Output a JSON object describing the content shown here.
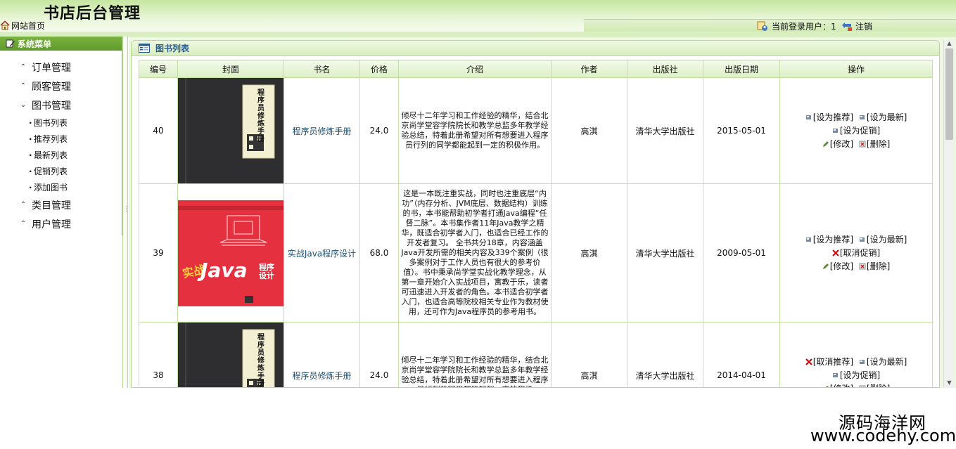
{
  "header": {
    "title": "书店后台管理",
    "home_link": "网站首页",
    "current_user_label": "当前登录用户：1",
    "logout_label": "注销"
  },
  "sidebar": {
    "title": "系统菜单",
    "groups": [
      {
        "label": "订单管理",
        "expanded": false
      },
      {
        "label": "顾客管理",
        "expanded": false
      },
      {
        "label": "图书管理",
        "expanded": true,
        "items": [
          "图书列表",
          "推荐列表",
          "最新列表",
          "促销列表",
          "添加图书"
        ]
      },
      {
        "label": "类目管理",
        "expanded": false
      },
      {
        "label": "用户管理",
        "expanded": false
      }
    ]
  },
  "panel": {
    "title": "图书列表"
  },
  "table": {
    "headers": [
      "编号",
      "封面",
      "书名",
      "价格",
      "介绍",
      "作者",
      "出版社",
      "出版日期",
      "操作"
    ],
    "rows": [
      {
        "id": "40",
        "name": "程序员修炼手册",
        "price": "24.0",
        "desc": "倾尽十二年学习和工作经验的精华，结合北京尚学堂容学院院长和教学总监多年教学经验总结，特着此册希望对所有想要进入程序员行列的同学都能起到一定的积极作用。",
        "author": "高淇",
        "publisher": "清华大学出版社",
        "date": "2015-05-01",
        "ops": [
          "[设为推荐]",
          "[设为最新]",
          "[设为促销]"
        ],
        "ops2": [
          "[修改]",
          "[删除]"
        ]
      },
      {
        "id": "39",
        "name": "实战Java程序设计",
        "price": "68.0",
        "desc": "这是一本既注重实战，同时也注重底层“内功”（内存分析、JVM底层、数据结构）训练的书，本书能帮助初学者打通Java编程“任督二脉”。本书集作者11年Java教学之精华，既适合初学者入门，也适合已经工作的开发者复习。 全书共分18章，内容涵盖Java开发所需的相关内容及339个案例（很多案例对于工作人员也有很大的参考价值）。书中秉承尚学堂实战化教学理念，从第一章开始介入实战项目，寓教于乐，读者可迅速进入开发者的角色。本书适合初学者入门，也适合高等院校相关专业作为教材使用，还可作为Java程序员的参考用书。",
        "author": "高淇",
        "publisher": "清华大学出版社",
        "date": "2009-05-01",
        "ops": [
          "[设为推荐]",
          "[设为最新]",
          "[取消促销]"
        ],
        "ops2": [
          "[修改]",
          "[删除]"
        ]
      },
      {
        "id": "38",
        "name": "程序员修炼手册",
        "price": "24.0",
        "desc": "倾尽十二年学习和工作经验的精华，结合北京尚学堂容学院院长和教学总监多年教学经验总结，特着此册希望对所有想要进入程序员行列的同学都能起到一定的积极",
        "author": "高淇",
        "publisher": "清华大学出版社",
        "date": "2014-04-01",
        "ops": [
          "[取消推荐]",
          "[设为最新]",
          "[设为促销]"
        ],
        "ops2": [
          "[修改]",
          "[删除]"
        ]
      }
    ]
  },
  "covers": {
    "book1_title": "程序员修炼手册",
    "java_cover_word": "Java",
    "java_cover_sub": "程序设计",
    "java_cover_side": "实战"
  },
  "watermark": {
    "line1": "源码海洋网",
    "line2": "www.codehy.com"
  },
  "colors": {
    "brand_green": "#6aa534",
    "header_light": "#e9f6d8",
    "link_blue": "#1f4f72",
    "cancel_red": "#cc0000"
  }
}
